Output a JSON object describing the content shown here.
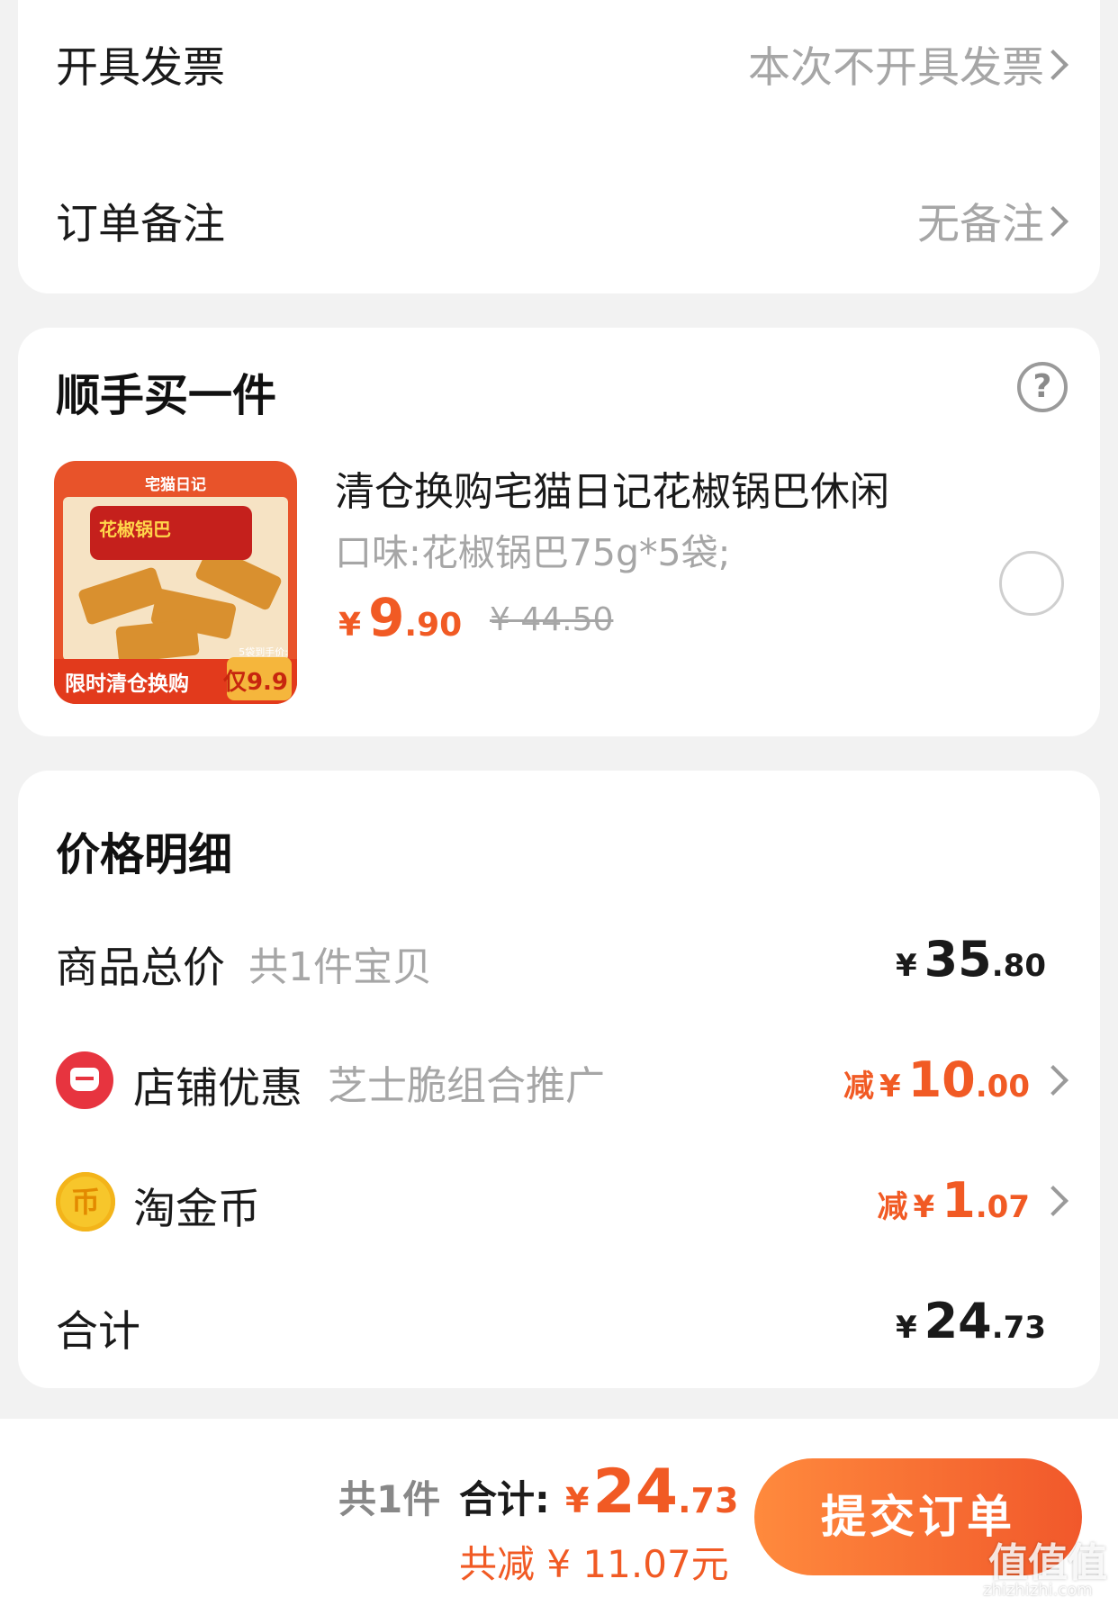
{
  "invoice": {
    "label": "开具发票",
    "value": "本次不开具发票"
  },
  "remark": {
    "label": "订单备注",
    "value": "无备注"
  },
  "addon": {
    "title": "顺手买一件",
    "thumb_brand": "宅猫日记",
    "thumb_bag": "花椒锅巴",
    "thumb_banner": "限时清仓换购",
    "thumb_badge_small": "5袋到手价:",
    "thumb_badge": "仅9.9",
    "product_title": "清仓换购宅猫日记花椒锅巴休闲",
    "product_spec": "口味:花椒锅巴75g*5袋;",
    "price_symbol": "¥",
    "price_int": "9",
    "price_dec": ".90",
    "original_price": "¥ 44.50"
  },
  "details": {
    "title": "价格明细",
    "goods_total": {
      "label": "商品总价",
      "sub": "共1件宝贝",
      "symbol": "¥",
      "int": "35",
      "dec": ".80"
    },
    "shop_discount": {
      "label": "店铺优惠",
      "sub": "芝士脆组合推广",
      "reduce": "减",
      "symbol": "¥",
      "int": "10",
      "dec": ".00"
    },
    "coins": {
      "label": "淘金币",
      "icon_char": "币",
      "reduce": "减",
      "symbol": "¥",
      "int": "1",
      "dec": ".07"
    },
    "total": {
      "label": "合计",
      "symbol": "¥",
      "int": "24",
      "dec": ".73"
    }
  },
  "bottom": {
    "count": "共1件",
    "total_label": "合计:",
    "symbol": "¥",
    "total_int": "24",
    "total_dec": ".73",
    "saved": "共减 ¥ 11.07元",
    "submit": "提交订单"
  },
  "watermark": {
    "main": "值值值",
    "site": "zhizhizhi.com"
  },
  "colors": {
    "accent": "#f15a24",
    "muted": "#a6a6a6",
    "shop_red": "#e7343f",
    "coin_gold": "#f7c62b"
  }
}
